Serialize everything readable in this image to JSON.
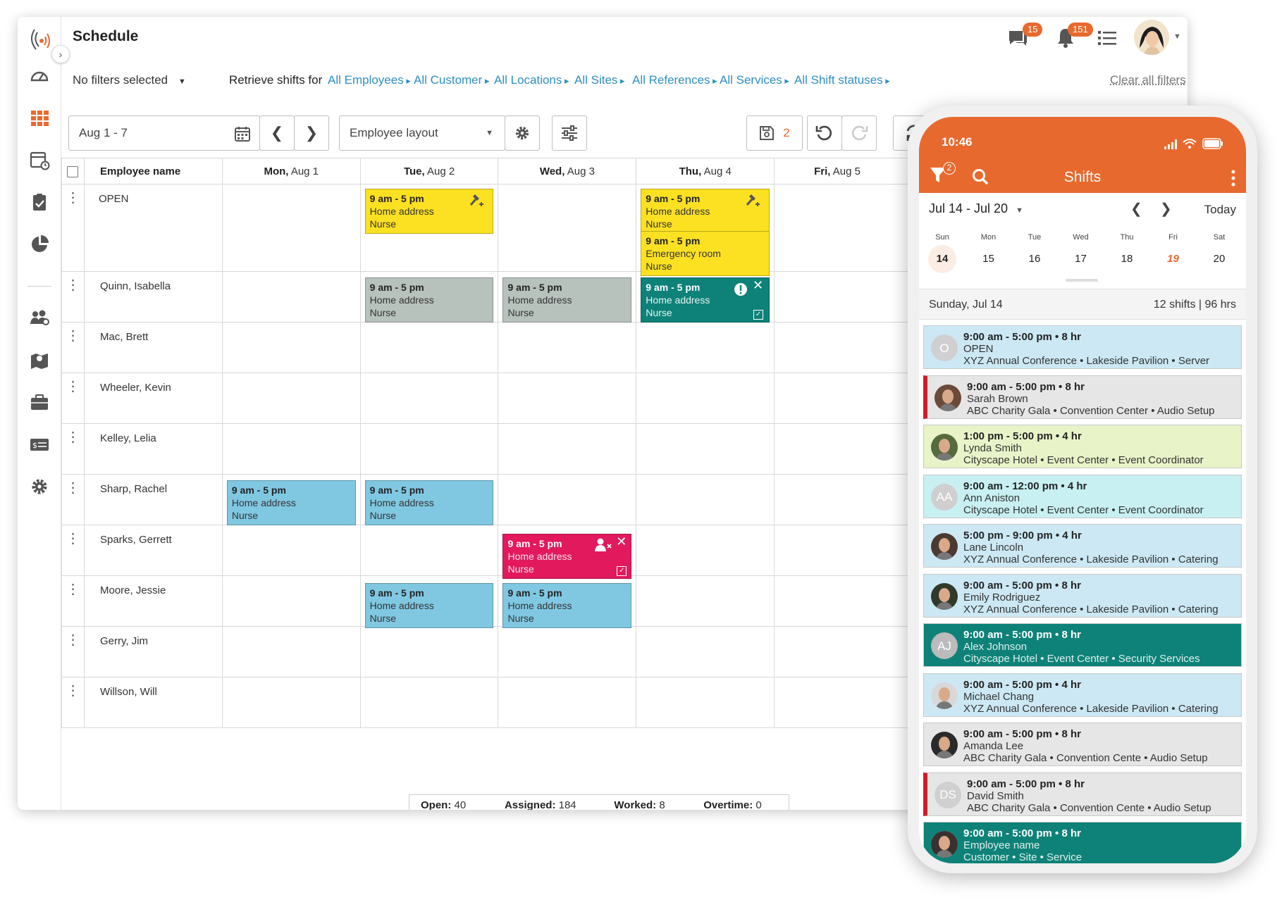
{
  "app": {
    "title": "Schedule",
    "chat_badge": "15",
    "notif_badge": "151"
  },
  "filters": {
    "no_filters": "No filters selected",
    "retrieve": "Retrieve shifts for",
    "links": [
      "All Employees",
      "All Customer",
      "All Locations",
      "All Sites",
      "All References",
      "All Services",
      "All Shift statuses"
    ],
    "clear": "Clear all filters"
  },
  "toolbar": {
    "date_range": "Aug 1 - 7",
    "layout": "Employee layout",
    "save_count": "2"
  },
  "grid": {
    "name_header": "Employee name",
    "days": [
      {
        "dow": "Mon,",
        "date": "Aug 1"
      },
      {
        "dow": "Tue,",
        "date": "Aug 2"
      },
      {
        "dow": "Wed,",
        "date": "Aug 3"
      },
      {
        "dow": "Thu,",
        "date": "Aug 4"
      },
      {
        "dow": "Fri,",
        "date": "Aug 5"
      }
    ],
    "employees": [
      "OPEN",
      "Quinn, Isabella",
      "Mac, Brett",
      "Wheeler, Kevin",
      "Kelley, Lelia",
      "Sharp, Rachel",
      "Sparks, Gerrett",
      "Moore, Jessie",
      "Gerry, Jim",
      "Willson, Will"
    ],
    "shift_time": "9 am - 5 pm",
    "addr_home": "Home address",
    "addr_er": "Emergency room",
    "role": "Nurse"
  },
  "totals": {
    "open_label": "Open:",
    "open": "40 hrs",
    "assigned_label": "Assigned:",
    "assigned": "184 hrs",
    "worked_label": "Worked:",
    "worked": "8 hrs",
    "overtime_label": "Overtime:",
    "overtime": "0 hrs"
  },
  "phone": {
    "time": "10:46",
    "title": "Shifts",
    "filter_badge": "2",
    "range": "Jul 14 - Jul 20",
    "today": "Today",
    "dows": [
      "Sun",
      "Mon",
      "Tue",
      "Wed",
      "Thu",
      "Fri",
      "Sat"
    ],
    "dates": [
      "14",
      "15",
      "16",
      "17",
      "18",
      "19",
      "20"
    ],
    "day_label": "Sunday, Jul 14",
    "day_summary": "12 shifts | 96 hrs",
    "cards": [
      {
        "time": "9:00 am - 5:00 pm • 8 hr",
        "name": "OPEN",
        "detail": "XYZ Annual Conference • Lakeside Pavilion • Server",
        "initials": "O"
      },
      {
        "time": "9:00 am - 5:00 pm • 8 hr",
        "name": "Sarah Brown",
        "detail": "ABC Charity Gala • Convention Center • Audio Setup",
        "initials": ""
      },
      {
        "time": "1:00 pm - 5:00 pm • 4 hr",
        "name": "Lynda Smith",
        "detail": "Cityscape Hotel • Event Center • Event Coordinator",
        "initials": ""
      },
      {
        "time": "9:00 am - 12:00 pm • 4 hr",
        "name": "Ann Aniston",
        "detail": "Cityscape Hotel • Event Center • Event Coordinator",
        "initials": "AA"
      },
      {
        "time": "5:00 pm - 9:00 pm • 4 hr",
        "name": "Lane Lincoln",
        "detail": "XYZ Annual Conference • Lakeside Pavilion • Catering",
        "initials": ""
      },
      {
        "time": "9:00 am - 5:00 pm • 8 hr",
        "name": "Emily Rodriguez",
        "detail": "XYZ Annual Conference • Lakeside Pavilion • Catering",
        "initials": ""
      },
      {
        "time": "9:00 am - 5:00 pm • 8 hr",
        "name": "Alex Johnson",
        "detail": "Cityscape Hotel • Event Center • Security Services",
        "initials": "AJ"
      },
      {
        "time": "9:00 am - 5:00 pm • 4 hr",
        "name": "Michael Chang",
        "detail": "XYZ Annual Conference • Lakeside Pavilion • Catering",
        "initials": ""
      },
      {
        "time": "9:00 am - 5:00 pm • 8 hr",
        "name": "Amanda Lee",
        "detail": "ABC Charity Gala • Convention Cente • Audio Setup",
        "initials": ""
      },
      {
        "time": "9:00 am - 5:00 pm • 8 hr",
        "name": "David Smith",
        "detail": "ABC Charity Gala • Convention Cente • Audio Setup",
        "initials": "DS"
      },
      {
        "time": "9:00 am - 5:00 pm • 8 hr",
        "name": "Employee name",
        "detail": "Customer • Site • Service",
        "initials": ""
      }
    ]
  },
  "colors": {
    "accent": "#e8692e",
    "link": "#2f8ec4",
    "shift_yellow": "#fbe122",
    "shift_gray": "#b8c2bd",
    "shift_blue": "#80c8e2",
    "shift_teal": "#0e8278",
    "shift_pink": "#e2195d"
  }
}
